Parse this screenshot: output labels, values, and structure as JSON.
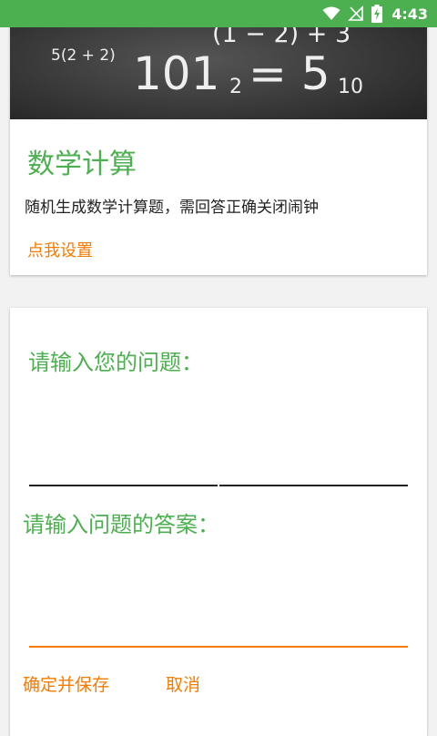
{
  "status_bar": {
    "time": "4:43"
  },
  "header_card": {
    "image_formulas": [
      "5(2 + 2)",
      "(1 − 2) + 3",
      "101",
      "2",
      "= 5",
      "10"
    ],
    "title": "数学计算",
    "description": "随机生成数学计算题，需回答正确关闭闹钟",
    "settings_link": "点我设置"
  },
  "question_form": {
    "question_label": "请输入您的问题：",
    "question_value": "",
    "answer_label": "请输入问题的答案：",
    "answer_value": "",
    "confirm_button": "确定并保存",
    "cancel_button": "取消"
  },
  "colors": {
    "accent_green": "#4caf50",
    "accent_orange": "#f57c00"
  }
}
